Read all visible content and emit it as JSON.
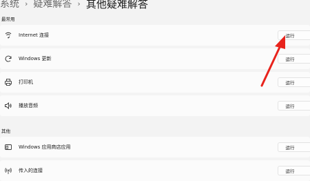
{
  "breadcrumb": {
    "items": [
      "系统",
      "疑难解答"
    ],
    "separator": "›",
    "current": "其他疑难解答"
  },
  "sections": {
    "frequent": "最常用",
    "other": "其他"
  },
  "rows": [
    {
      "label": "Internet 连接",
      "icon": "wifi-icon",
      "button": "运行"
    },
    {
      "label": "Windows 更新",
      "icon": "refresh-icon",
      "button": "运行"
    },
    {
      "label": "打印机",
      "icon": "printer-icon",
      "button": "运行"
    },
    {
      "label": "播放音频",
      "icon": "speaker-icon",
      "button": "运行"
    },
    {
      "label": "Windows 应用商店应用",
      "icon": "app-window-icon",
      "button": "运行"
    },
    {
      "label": "传入的连接",
      "icon": "antenna-icon",
      "button": "运行"
    }
  ],
  "colors": {
    "background": "#f3f3f3",
    "card": "#fbfbfb",
    "annotation_arrow": "#e8231c"
  }
}
